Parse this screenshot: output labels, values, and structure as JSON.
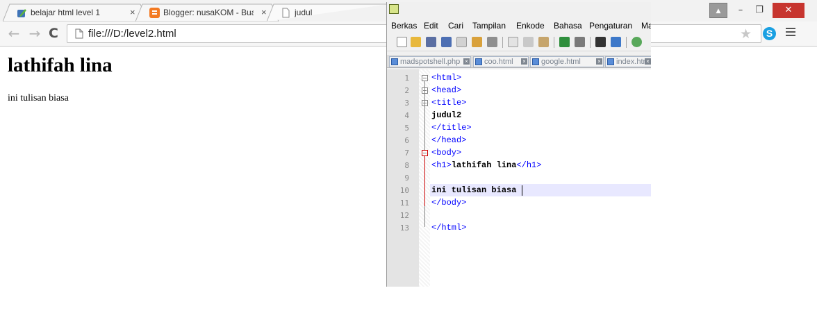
{
  "browser": {
    "tabs": [
      {
        "title": "belajar html level 1",
        "icon": "blogger-edit-icon",
        "close": "×"
      },
      {
        "title": "Blogger: nusaKOM - Buat",
        "icon": "blogger-icon",
        "close": "×"
      },
      {
        "title": "judul",
        "icon": "page-icon"
      }
    ],
    "url": "file:///D:/level2.html",
    "nav": {
      "back": "←",
      "forward": "→",
      "reload": "C"
    },
    "window_controls": {
      "user": "▲",
      "minimize": "–",
      "restore": "❐",
      "close": "✕"
    },
    "skype_label": "S",
    "star": "★"
  },
  "page": {
    "heading": "lathifah lina",
    "paragraph": "ini tulisan biasa"
  },
  "editor": {
    "menu": [
      "Berkas",
      "Edit",
      "Cari",
      "Tampilan",
      "Enkode",
      "Bahasa",
      "Pengaturan",
      "Ma"
    ],
    "file_tabs": [
      "madspotshell.php",
      "coo.html",
      "google.html",
      "index.html"
    ],
    "lines": [
      {
        "n": "1",
        "parts": [
          {
            "t": "<html>",
            "k": "tag"
          }
        ]
      },
      {
        "n": "2",
        "parts": [
          {
            "t": "<head>",
            "k": "tag"
          }
        ]
      },
      {
        "n": "3",
        "parts": [
          {
            "t": "<title>",
            "k": "tag"
          }
        ]
      },
      {
        "n": "4",
        "parts": [
          {
            "t": "judul2",
            "k": "txt"
          }
        ]
      },
      {
        "n": "5",
        "parts": [
          {
            "t": "</title>",
            "k": "tag"
          }
        ]
      },
      {
        "n": "6",
        "parts": [
          {
            "t": "</head>",
            "k": "tag"
          }
        ]
      },
      {
        "n": "7",
        "parts": [
          {
            "t": "<body>",
            "k": "tag"
          }
        ]
      },
      {
        "n": "8",
        "parts": [
          {
            "t": "<h1>",
            "k": "tag"
          },
          {
            "t": "lathifah lina",
            "k": "txt"
          },
          {
            "t": "</h1>",
            "k": "tag"
          }
        ]
      },
      {
        "n": "9",
        "parts": []
      },
      {
        "n": "10",
        "parts": [
          {
            "t": "ini tulisan biasa ",
            "k": "txt"
          }
        ]
      },
      {
        "n": "11",
        "parts": [
          {
            "t": "</body>",
            "k": "tag"
          }
        ]
      },
      {
        "n": "12",
        "parts": []
      },
      {
        "n": "13",
        "parts": [
          {
            "t": "</html>",
            "k": "tag"
          }
        ]
      }
    ],
    "current_line": 10,
    "colors": {
      "tag": "#0000ff",
      "text": "#000000",
      "current_line": "#e8e8ff",
      "fold_active": "#cc0000"
    }
  }
}
